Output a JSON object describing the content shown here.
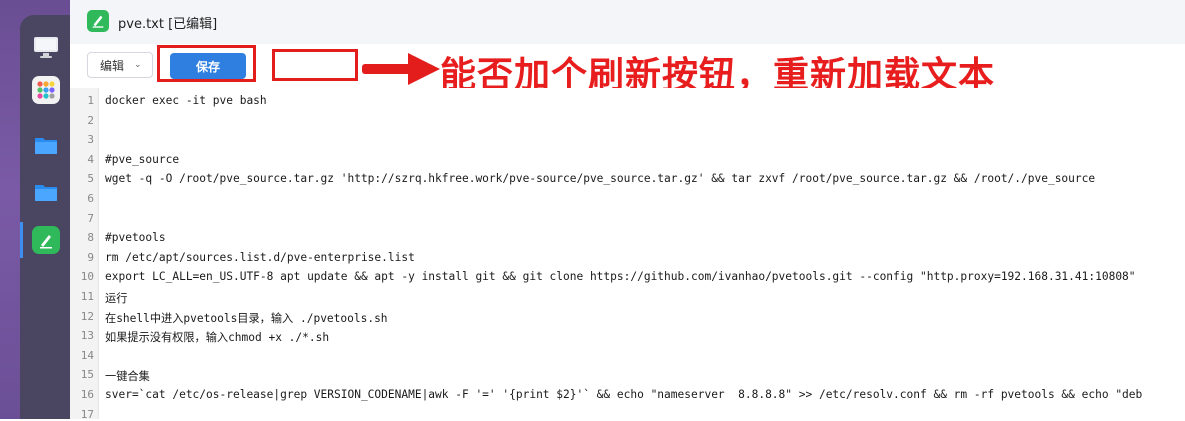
{
  "window": {
    "title": "pve.txt [已编辑]"
  },
  "toolbar": {
    "edit_label": "编辑",
    "save_label": "保存"
  },
  "annotation": {
    "text": "能否加个刷新按钮，重新加载文本",
    "color": "#e81e1e"
  },
  "dock": {
    "items": [
      {
        "name": "monitor-icon"
      },
      {
        "name": "app-grid-icon"
      },
      {
        "name": "folder-icon"
      },
      {
        "name": "folder-icon"
      },
      {
        "name": "text-editor-icon",
        "active": true
      }
    ]
  },
  "editor": {
    "lines": [
      {
        "no": "1",
        "text": "docker exec -it pve bash"
      },
      {
        "no": "2",
        "text": ""
      },
      {
        "no": "3",
        "text": ""
      },
      {
        "no": "4",
        "text": "#pve_source"
      },
      {
        "no": "5",
        "text": "wget -q -O /root/pve_source.tar.gz 'http://szrq.hkfree.work/pve-source/pve_source.tar.gz' && tar zxvf /root/pve_source.tar.gz && /root/./pve_source"
      },
      {
        "no": "6",
        "text": ""
      },
      {
        "no": "7",
        "text": ""
      },
      {
        "no": "8",
        "text": "#pvetools"
      },
      {
        "no": "9",
        "text": "rm /etc/apt/sources.list.d/pve-enterprise.list"
      },
      {
        "no": "10",
        "text": "export LC_ALL=en_US.UTF-8 apt update && apt -y install git && git clone https://github.com/ivanhao/pvetools.git --config \"http.proxy=192.168.31.41:10808\""
      },
      {
        "no": "11",
        "text": "运行"
      },
      {
        "no": "12",
        "text": "在shell中进入pvetools目录，输入 ./pvetools.sh"
      },
      {
        "no": "13",
        "text": "如果提示没有权限，输入chmod +x ./*.sh"
      },
      {
        "no": "14",
        "text": ""
      },
      {
        "no": "15",
        "text": "一键合集"
      },
      {
        "no": "16",
        "text": "sver=`cat /etc/os-release|grep VERSION_CODENAME|awk -F '=' '{print $2}'` && echo \"nameserver  8.8.8.8\" >> /etc/resolv.conf && rm -rf pvetools && echo \"deb"
      },
      {
        "no": "17",
        "text": ""
      }
    ]
  }
}
